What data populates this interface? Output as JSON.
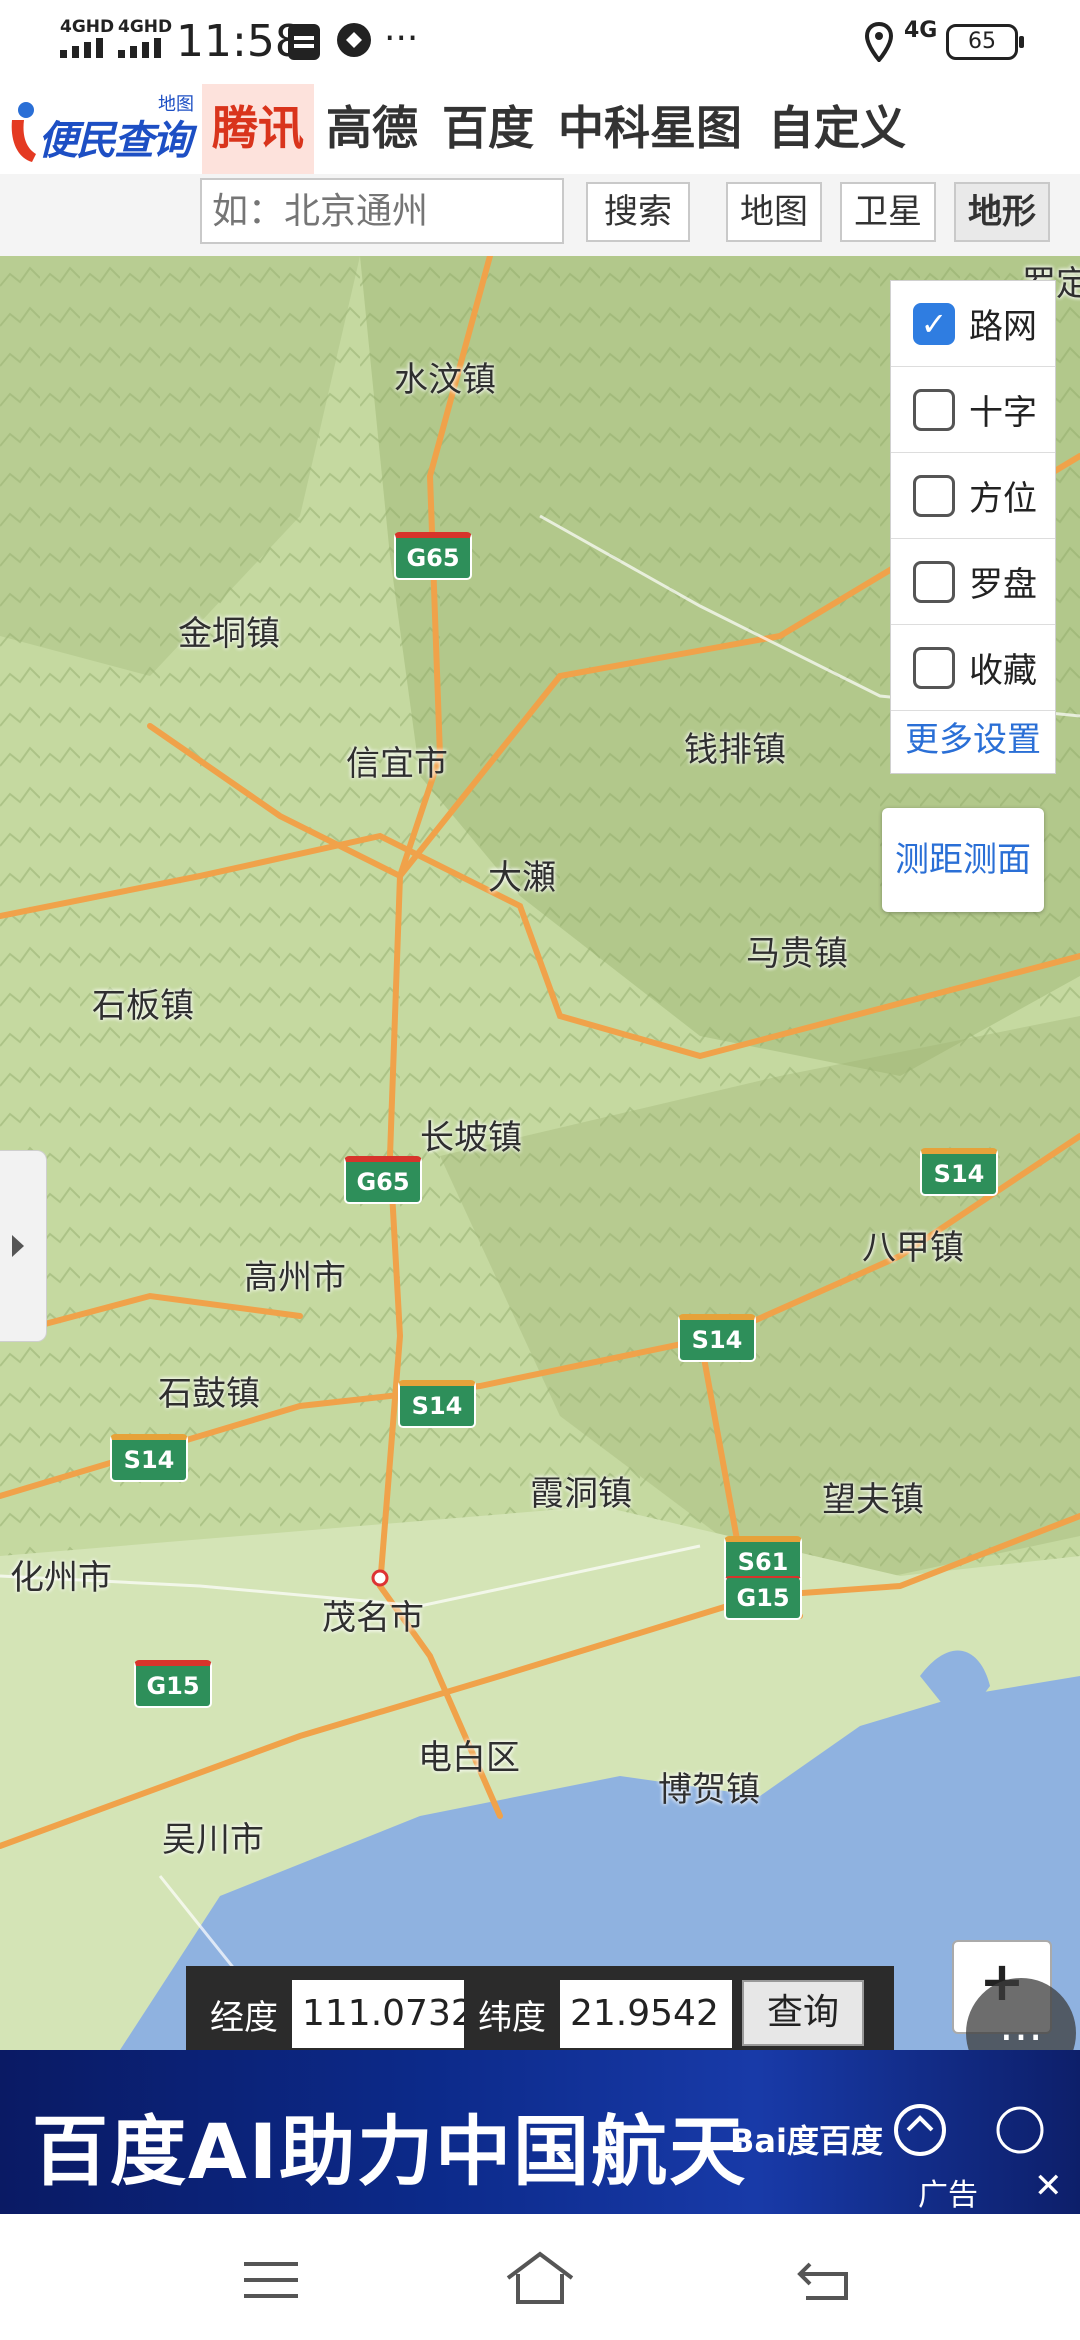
{
  "status_bar": {
    "net1": "4GHD",
    "net2": "4GHD",
    "time": "11:58",
    "net3": "4G",
    "battery": "65"
  },
  "nav": {
    "logo_text": "便民查询网",
    "logo_small": "地图",
    "tabs": [
      {
        "label": "腾讯",
        "active": true
      },
      {
        "label": "高德"
      },
      {
        "label": "百度"
      },
      {
        "label": "中科星图"
      },
      {
        "label": "自定义"
      }
    ]
  },
  "search": {
    "placeholder": "如：北京通州",
    "button": "搜索",
    "map_types": [
      "地图",
      "卫星",
      "地形"
    ],
    "active_map_type": "地形"
  },
  "layers": {
    "items": [
      {
        "label": "路网",
        "checked": true
      },
      {
        "label": "十字",
        "checked": false
      },
      {
        "label": "方位",
        "checked": false
      },
      {
        "label": "罗盘",
        "checked": false
      },
      {
        "label": "收藏",
        "checked": false
      }
    ],
    "more": "更多设置"
  },
  "measure_button": "测距测面",
  "places": {
    "shuiwen": "水汶镇",
    "jindong": "金垌镇",
    "xinyi": "信宜市",
    "qianpai": "钱排镇",
    "dacheng": "大瀬",
    "maogui": "马贵镇",
    "shiban": "石板镇",
    "changpo": "长坡镇",
    "bajia": "八甲镇",
    "gaozhou": "高州市",
    "shigu": "石鼓镇",
    "xiadong": "霞洞镇",
    "wangfu": "望夫镇",
    "huazhou": "化州市",
    "maoming": "茂名市",
    "dianbai": "电白区",
    "bohe": "博贺镇",
    "wuchuan": "吴川市",
    "luo": "罗定"
  },
  "roads": {
    "g65": "G65",
    "s14": "S14",
    "s61": "S61",
    "g15": "G15"
  },
  "coord": {
    "lng_label": "经度",
    "lng_value": "111.0732",
    "lat_label": "纬度",
    "lat_value": "21.9542",
    "query": "查询"
  },
  "ad": {
    "text": "百度AI助力中国航天",
    "brand": "Bai度百度",
    "label": "广告"
  },
  "colors": {
    "terrain": "#c9dca6",
    "sea": "#8fb2e0",
    "road": "#f0a24a",
    "accent": "#2a6fd6",
    "active_tab": "#d9341c"
  }
}
